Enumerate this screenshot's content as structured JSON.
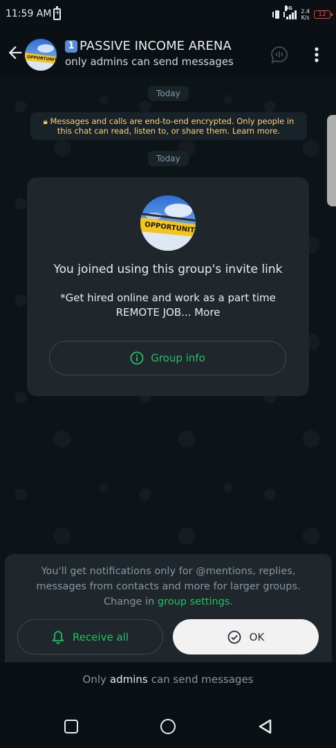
{
  "status_bar": {
    "time": "11:59 AM",
    "network_type": "4G",
    "speed_value": "2.4",
    "speed_unit": "K/s",
    "battery_level": "12"
  },
  "header": {
    "title_badge": "1",
    "title": "PASSIVE INCOME ARENA",
    "subtitle": "only admins can send messages",
    "avatar_label": "OPPORTUNITIES"
  },
  "chat": {
    "date_label_1": "Today",
    "encryption_notice": "Messages and calls are end-to-end encrypted. Only people in this chat can read, listen to, or share them. Learn more.",
    "date_label_2": "Today",
    "system_card": {
      "avatar_label": "OPPORTUNITIES",
      "joined_text": "You joined using this group's invite link",
      "description": "*Get hired online and work as a part time REMOTE JOB...",
      "more_label": "More",
      "group_info_label": "Group info"
    }
  },
  "notification_panel": {
    "text": "You'll get notifications only for @mentions, replies, messages from contacts and more for larger groups. Change in",
    "link_text": "group settings",
    "text_end": ".",
    "receive_all_label": "Receive all",
    "ok_label": "OK"
  },
  "footer": {
    "prefix": "Only",
    "admins": "admins",
    "suffix": "can send messages"
  },
  "colors": {
    "accent_green": "#21c063",
    "background": "#0b1014",
    "card": "#1f272d",
    "battery_low": "#ff3b30"
  }
}
